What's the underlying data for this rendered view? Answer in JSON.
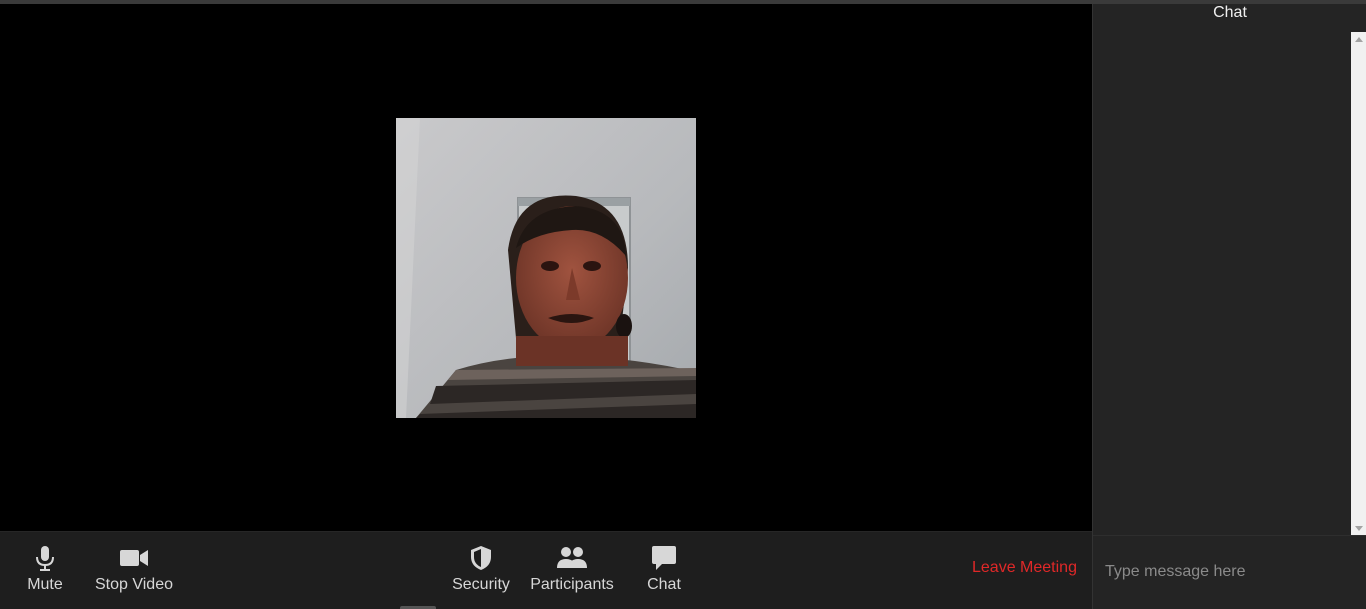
{
  "meeting": {
    "toolbar": {
      "mute_label": "Mute",
      "stop_video_label": "Stop Video",
      "security_label": "Security",
      "participants_label": "Participants",
      "chat_label": "Chat",
      "leave_label": "Leave Meeting"
    },
    "video": {
      "participant_icon": "participant-video"
    }
  },
  "chat": {
    "title": "Chat",
    "input_placeholder": "Type message here"
  },
  "colors": {
    "leave": "#e02828",
    "toolbar_bg": "#1e1e1e",
    "chat_bg": "#242424",
    "stage_bg": "#000000"
  }
}
